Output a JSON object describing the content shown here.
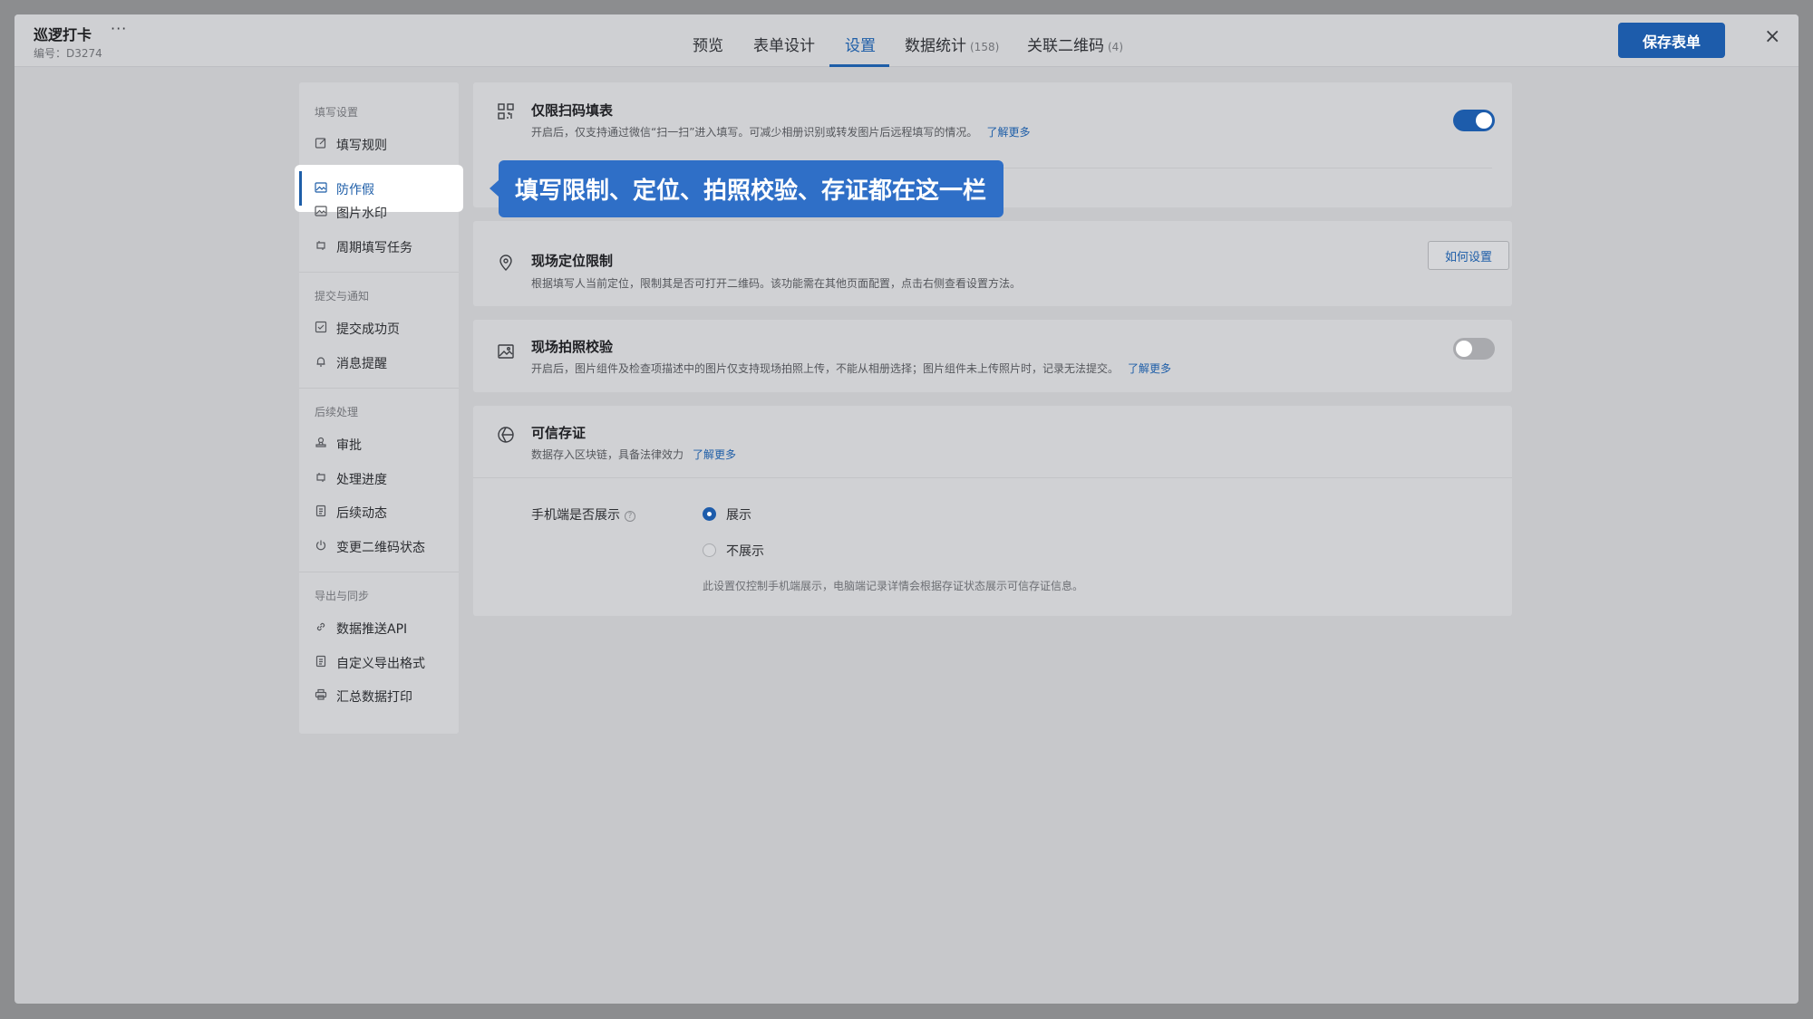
{
  "header": {
    "app_title": "巡逻打卡",
    "more": "···",
    "code": "编号：D3274",
    "tabs": [
      {
        "label": "预览",
        "count": ""
      },
      {
        "label": "表单设计",
        "count": ""
      },
      {
        "label": "设置",
        "count": ""
      },
      {
        "label": "数据统计",
        "count": "(158)"
      },
      {
        "label": "关联二维码",
        "count": "(4)"
      }
    ],
    "active_tab": "设置",
    "save_label": "保存表单",
    "close": "×"
  },
  "sidebar": {
    "groups": [
      {
        "title": "填写设置",
        "items": [
          {
            "label": "填写规则",
            "icon": "edit-icon"
          },
          {
            "label": "防作假",
            "icon": "image-icon",
            "active": true
          },
          {
            "label": "图片水印",
            "icon": "image-icon"
          },
          {
            "label": "周期填写任务",
            "icon": "cycle-icon"
          }
        ]
      },
      {
        "title": "提交与通知",
        "items": [
          {
            "label": "提交成功页",
            "icon": "check-icon"
          },
          {
            "label": "消息提醒",
            "icon": "bell-icon"
          }
        ]
      },
      {
        "title": "后续处理",
        "items": [
          {
            "label": "审批",
            "icon": "stamp-icon"
          },
          {
            "label": "处理进度",
            "icon": "cycle-icon"
          },
          {
            "label": "后续动态",
            "icon": "doc-icon"
          },
          {
            "label": "变更二维码状态",
            "icon": "power-icon"
          }
        ]
      },
      {
        "title": "导出与同步",
        "items": [
          {
            "label": "数据推送API",
            "icon": "link-icon"
          },
          {
            "label": "自定义导出格式",
            "icon": "doc-icon"
          },
          {
            "label": "汇总数据打印",
            "icon": "printer-icon"
          }
        ]
      }
    ]
  },
  "tooltip": "填写限制、定位、拍照校验、存证都在这一栏",
  "cards": {
    "scan_only": {
      "title": "仅限扫码填表",
      "desc": "开启后，仅支持通过微信“扫一扫”进入填写。可减少相册识别或转发图片后远程填写的情况。",
      "link": "了解更多",
      "enabled": true
    },
    "location": {
      "title": "现场定位限制",
      "desc": "根据填写人当前定位，限制其是否可打开二维码。该功能需在其他页面配置，点击右侧查看设置方法。",
      "button": "如何设置"
    },
    "photo": {
      "title": "现场拍照校验",
      "desc": "开启后，图片组件及检查项描述中的图片仅支持现场拍照上传，不能从相册选择；图片组件未上传照片时，记录无法提交。",
      "link": "了解更多",
      "enabled": false
    },
    "trusted": {
      "title": "可信存证",
      "desc": "数据存入区块链，具备法律效力",
      "link": "了解更多",
      "field_label": "手机端是否展示",
      "help": "?",
      "options": [
        "展示",
        "不展示"
      ],
      "selected": "展示",
      "note": "此设置仅控制手机端展示，电脑端记录详情会根据存证状态展示可信存证信息。"
    }
  },
  "colors": {
    "accent": "#1d5cab",
    "tooltip": "#2f6fc7",
    "overlay_bg": "#c7c8cb"
  }
}
